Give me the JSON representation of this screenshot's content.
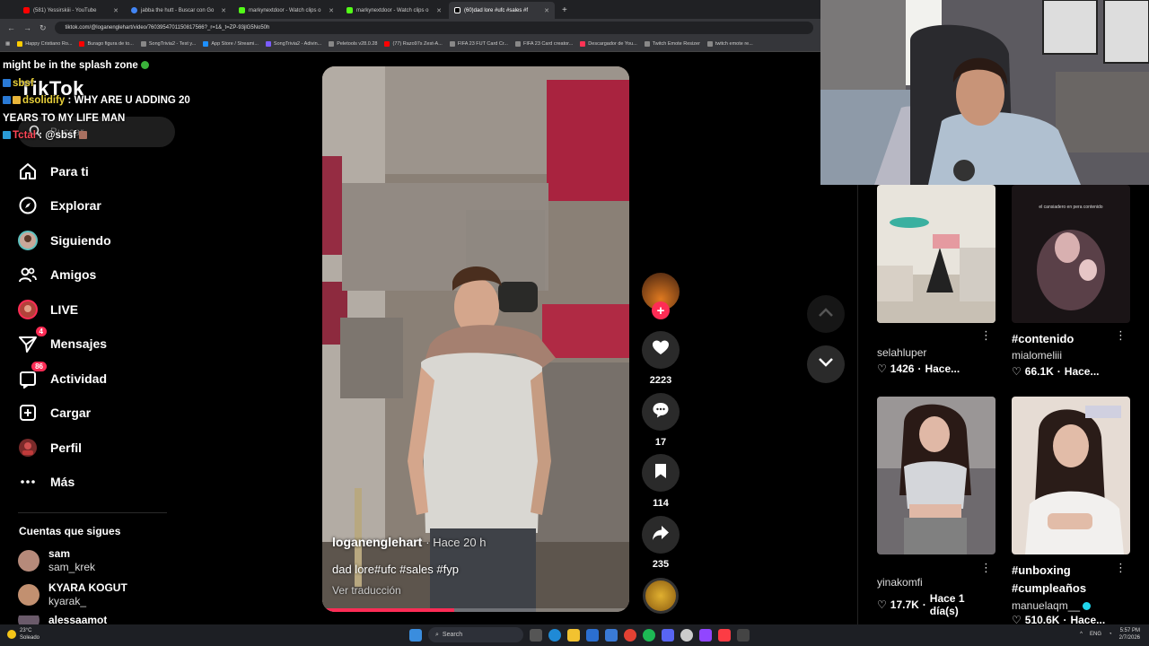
{
  "browser": {
    "tabs": [
      {
        "title": "(581) Yessirskiii - YouTube",
        "color": "#ff0000",
        "active": false
      },
      {
        "title": "jabba the hutt - Buscar con Go",
        "color": "#4285f4",
        "active": false
      },
      {
        "title": "markynextdoor - Watch clips o",
        "color": "#53fc18",
        "active": false
      },
      {
        "title": "markynextdoor - Watch clips o",
        "color": "#53fc18",
        "active": false
      },
      {
        "title": "(60)dad lore #ufc #sales #f",
        "color": "#ffffff",
        "active": true
      }
    ],
    "new_tab": "+",
    "url": "tiktok.com/@loganenglehart/video/7603954701150817566?_r=1&_t=ZP-93jlG5No50h",
    "bookmarks": [
      "Happy Cristiano Ro...",
      "Burago figura de to...",
      "SongTrivia2 - Test y...",
      "App Store / Streami...",
      "SongTrivia2 - Adivin...",
      "Peletools v28.0.28",
      "(77) Razo97s Zest-A...",
      "FIFA 23 FUT Card Cr...",
      "FIFA 23 Card creator...",
      "Descargador de You...",
      "Twitch Emote Resizer",
      "twitch emote re..."
    ]
  },
  "logo": "TikTok",
  "search": {
    "placeholder": "Buscar"
  },
  "chat": [
    {
      "user": "",
      "text": "might be in the splash zone"
    },
    {
      "user": "sbsf",
      "text": ""
    },
    {
      "user": "dsolidify",
      "text": "WHY ARE U ADDING 20 YEARS TO MY LIFE MAN"
    },
    {
      "user": "Tctal",
      "text": "@sbsf"
    }
  ],
  "nav": [
    {
      "label": "Para ti",
      "icon": "home-icon"
    },
    {
      "label": "Explorar",
      "icon": "compass-icon"
    },
    {
      "label": "Siguiendo",
      "icon": "following-avatar-icon"
    },
    {
      "label": "Amigos",
      "icon": "friends-icon"
    },
    {
      "label": "LIVE",
      "icon": "live-icon"
    },
    {
      "label": "Mensajes",
      "icon": "send-icon",
      "badge": "4"
    },
    {
      "label": "Actividad",
      "icon": "inbox-icon",
      "badge": "86"
    },
    {
      "label": "Cargar",
      "icon": "upload-icon"
    },
    {
      "label": "Perfil",
      "icon": "profile-avatar-icon"
    },
    {
      "label": "Más",
      "icon": "more-icon"
    }
  ],
  "following": {
    "title": "Cuentas que sigues",
    "accounts": [
      {
        "name": "sam",
        "user": "sam_krek"
      },
      {
        "name": "KYARA KOGUT",
        "user": "kyarak_"
      },
      {
        "name": "alessaamot",
        "user": ""
      }
    ]
  },
  "video": {
    "author": "loganenglehart",
    "time": "· Hace 20 h",
    "caption": "dad lore#ufc #sales #fyp",
    "translate": "Ver traducción",
    "progress": 0.43,
    "likes": "2223",
    "comments": "17",
    "saves": "114",
    "shares": "235"
  },
  "grid": [
    {
      "user": "selahluper",
      "tag": "",
      "likes": "1426",
      "time": "Hace..."
    },
    {
      "user": "mialomeliii",
      "tag": "#contenido",
      "likes": "66.1K",
      "time": "Hace..."
    },
    {
      "user": "yinakomfi",
      "tag": "",
      "likes": "17.7K",
      "time": "Hace 1 día(s)"
    },
    {
      "user": "manuelaqm__",
      "tag": "#unboxing #cumpleaños",
      "likes": "510.6K",
      "time": "Hace..."
    }
  ],
  "grid_thumb_text": "el cansiadero en pera contenido",
  "taskbar": {
    "weather_temp": "23°C",
    "weather_desc": "Soleado",
    "search": "Search",
    "lang": "ENG",
    "time": "5:57 PM",
    "date": "2/7/2026"
  },
  "colors": {
    "accent": "#fe2c55",
    "bg": "#000000",
    "chat_name": "#e8d03a"
  }
}
